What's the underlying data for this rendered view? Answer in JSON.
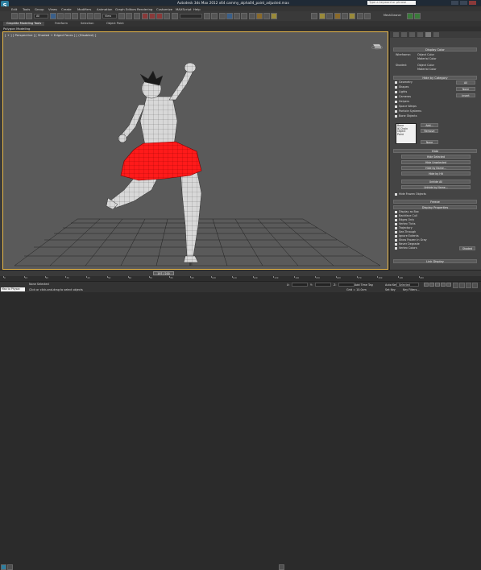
{
  "app": {
    "title": "Autodesk 3ds Max  2012 x64   cammy_alpha04_paint_adjusted.max",
    "search_placeholder": "Type a keyword or phrase",
    "logo": "S"
  },
  "menu": [
    "Edit",
    "Tools",
    "Group",
    "Views",
    "Create",
    "Modifiers",
    "Animation",
    "Graph Editors",
    "Rendering",
    "Customize",
    "MAXScript",
    "Help"
  ],
  "toolbar": {
    "selection_filter": "All",
    "reference_coord": "View",
    "named_selection": ""
  },
  "ribbon": {
    "tabs": [
      "Graphite Modeling Tools",
      "Freeform",
      "Selection",
      "Object Paint"
    ],
    "active_tab": "Graphite Modeling Tools",
    "sub_label": "Polygon Modeling"
  },
  "viewport": {
    "label": "[ + ] [ Perspective ] [ Shaded + Edged Faces ] [ (Disabled) ]",
    "accent_color": "#e8b84a",
    "highlight_color": "#ff1a1a"
  },
  "panel": {
    "display_color": {
      "header": "Display Color",
      "wireframe_label": "Wireframe:",
      "shaded_label": "Shaded:",
      "opt1": "Object Color",
      "opt2": "Material Color"
    },
    "hide_by_category": {
      "header": "Hide by Category",
      "items": [
        "Geometry",
        "Shapes",
        "Lights",
        "Cameras",
        "Helpers",
        "Space Warps",
        "Particle Systems",
        "Bone Objects"
      ],
      "all_btn": "All",
      "none_btn": "None",
      "invert_btn": "Invert",
      "list_items": [
        "Bone",
        "IK Chain Object",
        "Point"
      ],
      "add_btn": "Add...",
      "remove_btn": "Remove",
      "none2_btn": "None"
    },
    "hide": {
      "header": "Hide",
      "buttons": [
        "Hide Selected",
        "Hide Unselected",
        "Hide by Name...",
        "Hide by Hit",
        "Unhide All",
        "Unhide by Name..."
      ],
      "checkbox": "Hide Frozen Objects"
    },
    "freeze": {
      "header": "Freeze"
    },
    "display_properties": {
      "header": "Display Properties",
      "items": [
        "Display as Box",
        "Backface Cull",
        "Edges Only",
        "Vertex Ticks",
        "Trajectory",
        "See-Through",
        "Ignore Extents",
        "Show Frozen in Gray",
        "Never Degrade",
        "Vertex Colors"
      ],
      "shaded_btn": "Shaded"
    },
    "link_display": {
      "header": "Link Display"
    }
  },
  "timeline": {
    "frame_label": "197 / 200",
    "ruler_labels": [
      "0",
      "10",
      "20",
      "30",
      "40",
      "50",
      "60",
      "70",
      "80",
      "90",
      "100",
      "110",
      "120",
      "130",
      "140",
      "150",
      "160",
      "170",
      "180",
      "190",
      "200"
    ]
  },
  "status": {
    "maxscript": "Max to Physac",
    "status_text": "None Selected",
    "prompt_text": "Click or click-and-drag to select objects",
    "x_label": "X:",
    "y_label": "Y:",
    "z_label": "Z:",
    "grid_text": "Grid = 10.0cm",
    "autokey": "Auto Key",
    "selected_option": "Selected",
    "set_key": "Set Key",
    "key_filters": "Key Filters...",
    "add_time_tag": "Add Time Tag"
  }
}
